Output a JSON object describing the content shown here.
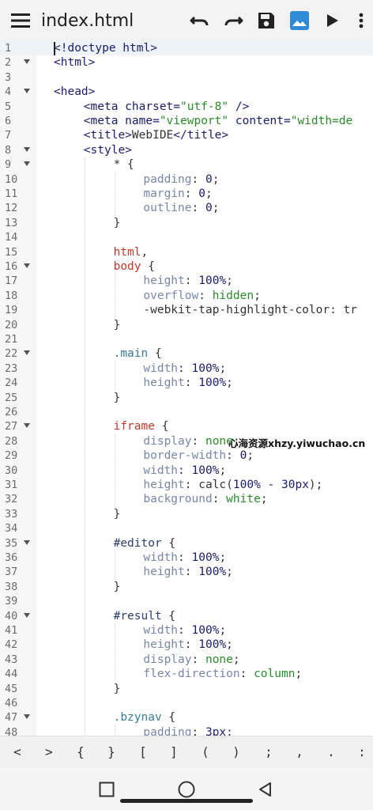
{
  "toolbar": {
    "title": "index.html",
    "icons": [
      "menu-icon",
      "undo-icon",
      "redo-icon",
      "save-icon",
      "image-icon",
      "run-icon",
      "more-vert-icon"
    ]
  },
  "editor": {
    "lines": [
      {
        "n": "1",
        "fold": false,
        "indent": 0,
        "tokens": [
          [
            "tag",
            "<!doctype html>"
          ]
        ]
      },
      {
        "n": "2",
        "fold": true,
        "indent": 0,
        "tokens": [
          [
            "tag",
            "<html>"
          ]
        ]
      },
      {
        "n": "3",
        "fold": false,
        "indent": 0,
        "tokens": []
      },
      {
        "n": "4",
        "fold": true,
        "indent": 0,
        "tokens": [
          [
            "tag",
            "<head>"
          ]
        ]
      },
      {
        "n": "5",
        "fold": false,
        "indent": 1,
        "tokens": [
          [
            "tag",
            "<meta charset="
          ],
          [
            "str",
            "\"utf-8\""
          ],
          [
            "tag",
            " />"
          ]
        ]
      },
      {
        "n": "6",
        "fold": false,
        "indent": 1,
        "tokens": [
          [
            "tag",
            "<meta name="
          ],
          [
            "str",
            "\"viewport\""
          ],
          [
            "tag",
            " content="
          ],
          [
            "str",
            "\"width=de"
          ]
        ]
      },
      {
        "n": "7",
        "fold": false,
        "indent": 1,
        "tokens": [
          [
            "tag",
            "<title>"
          ],
          [
            "punc",
            "WebIDE"
          ],
          [
            "tag",
            "</title>"
          ]
        ]
      },
      {
        "n": "8",
        "fold": true,
        "indent": 1,
        "tokens": [
          [
            "tag",
            "<style>"
          ]
        ]
      },
      {
        "n": "9",
        "fold": true,
        "indent": 2,
        "tokens": [
          [
            "punc",
            "* {"
          ]
        ]
      },
      {
        "n": "10",
        "fold": false,
        "indent": 3,
        "tokens": [
          [
            "prop",
            "padding"
          ],
          [
            "punc",
            ": "
          ],
          [
            "num",
            "0"
          ],
          [
            "punc",
            ";"
          ]
        ]
      },
      {
        "n": "11",
        "fold": false,
        "indent": 3,
        "tokens": [
          [
            "prop",
            "margin"
          ],
          [
            "punc",
            ": "
          ],
          [
            "num",
            "0"
          ],
          [
            "punc",
            ";"
          ]
        ]
      },
      {
        "n": "12",
        "fold": false,
        "indent": 3,
        "tokens": [
          [
            "prop",
            "outline"
          ],
          [
            "punc",
            ": "
          ],
          [
            "num",
            "0"
          ],
          [
            "punc",
            ";"
          ]
        ]
      },
      {
        "n": "13",
        "fold": false,
        "indent": 2,
        "tokens": [
          [
            "punc",
            "}"
          ]
        ]
      },
      {
        "n": "14",
        "fold": false,
        "indent": 0,
        "tokens": []
      },
      {
        "n": "15",
        "fold": false,
        "indent": 2,
        "tokens": [
          [
            "sel",
            "html"
          ],
          [
            "punc",
            ","
          ]
        ]
      },
      {
        "n": "16",
        "fold": true,
        "indent": 2,
        "tokens": [
          [
            "sel",
            "body"
          ],
          [
            "punc",
            " {"
          ]
        ]
      },
      {
        "n": "17",
        "fold": false,
        "indent": 3,
        "tokens": [
          [
            "prop",
            "height"
          ],
          [
            "punc",
            ": "
          ],
          [
            "num",
            "100%"
          ],
          [
            "punc",
            ";"
          ]
        ]
      },
      {
        "n": "18",
        "fold": false,
        "indent": 3,
        "tokens": [
          [
            "prop",
            "overflow"
          ],
          [
            "punc",
            ": "
          ],
          [
            "kw",
            "hidden"
          ],
          [
            "punc",
            ";"
          ]
        ]
      },
      {
        "n": "19",
        "fold": false,
        "indent": 3,
        "tokens": [
          [
            "punc",
            "-webkit-tap-highlight-color: tr"
          ]
        ]
      },
      {
        "n": "20",
        "fold": false,
        "indent": 2,
        "tokens": [
          [
            "punc",
            "}"
          ]
        ]
      },
      {
        "n": "21",
        "fold": false,
        "indent": 0,
        "tokens": []
      },
      {
        "n": "22",
        "fold": true,
        "indent": 2,
        "tokens": [
          [
            "cls",
            ".main"
          ],
          [
            "punc",
            " {"
          ]
        ]
      },
      {
        "n": "23",
        "fold": false,
        "indent": 3,
        "tokens": [
          [
            "prop",
            "width"
          ],
          [
            "punc",
            ": "
          ],
          [
            "num",
            "100%"
          ],
          [
            "punc",
            ";"
          ]
        ]
      },
      {
        "n": "24",
        "fold": false,
        "indent": 3,
        "tokens": [
          [
            "prop",
            "height"
          ],
          [
            "punc",
            ": "
          ],
          [
            "num",
            "100%"
          ],
          [
            "punc",
            ";"
          ]
        ]
      },
      {
        "n": "25",
        "fold": false,
        "indent": 2,
        "tokens": [
          [
            "punc",
            "}"
          ]
        ]
      },
      {
        "n": "26",
        "fold": false,
        "indent": 0,
        "tokens": []
      },
      {
        "n": "27",
        "fold": true,
        "indent": 2,
        "tokens": [
          [
            "sel",
            "iframe"
          ],
          [
            "punc",
            " {"
          ]
        ]
      },
      {
        "n": "28",
        "fold": false,
        "indent": 3,
        "tokens": [
          [
            "prop",
            "display"
          ],
          [
            "punc",
            ": "
          ],
          [
            "kw",
            "none"
          ],
          [
            "punc",
            ";"
          ]
        ]
      },
      {
        "n": "29",
        "fold": false,
        "indent": 3,
        "tokens": [
          [
            "prop",
            "border-width"
          ],
          [
            "punc",
            ": "
          ],
          [
            "num",
            "0"
          ],
          [
            "punc",
            ";"
          ]
        ]
      },
      {
        "n": "30",
        "fold": false,
        "indent": 3,
        "tokens": [
          [
            "prop",
            "width"
          ],
          [
            "punc",
            ": "
          ],
          [
            "num",
            "100%"
          ],
          [
            "punc",
            ";"
          ]
        ]
      },
      {
        "n": "31",
        "fold": false,
        "indent": 3,
        "tokens": [
          [
            "prop",
            "height"
          ],
          [
            "punc",
            ": calc("
          ],
          [
            "num",
            "100% - 30px"
          ],
          [
            "punc",
            ");"
          ]
        ]
      },
      {
        "n": "32",
        "fold": false,
        "indent": 3,
        "tokens": [
          [
            "prop",
            "background"
          ],
          [
            "punc",
            ": "
          ],
          [
            "kw",
            "white"
          ],
          [
            "punc",
            ";"
          ]
        ]
      },
      {
        "n": "33",
        "fold": false,
        "indent": 2,
        "tokens": [
          [
            "punc",
            "}"
          ]
        ]
      },
      {
        "n": "34",
        "fold": false,
        "indent": 0,
        "tokens": []
      },
      {
        "n": "35",
        "fold": true,
        "indent": 2,
        "tokens": [
          [
            "id",
            "#editor"
          ],
          [
            "punc",
            " {"
          ]
        ]
      },
      {
        "n": "36",
        "fold": false,
        "indent": 3,
        "tokens": [
          [
            "prop",
            "width"
          ],
          [
            "punc",
            ": "
          ],
          [
            "num",
            "100%"
          ],
          [
            "punc",
            ";"
          ]
        ]
      },
      {
        "n": "37",
        "fold": false,
        "indent": 3,
        "tokens": [
          [
            "prop",
            "height"
          ],
          [
            "punc",
            ": "
          ],
          [
            "num",
            "100%"
          ],
          [
            "punc",
            ";"
          ]
        ]
      },
      {
        "n": "38",
        "fold": false,
        "indent": 2,
        "tokens": [
          [
            "punc",
            "}"
          ]
        ]
      },
      {
        "n": "39",
        "fold": false,
        "indent": 0,
        "tokens": []
      },
      {
        "n": "40",
        "fold": true,
        "indent": 2,
        "tokens": [
          [
            "id",
            "#result"
          ],
          [
            "punc",
            " {"
          ]
        ]
      },
      {
        "n": "41",
        "fold": false,
        "indent": 3,
        "tokens": [
          [
            "prop",
            "width"
          ],
          [
            "punc",
            ": "
          ],
          [
            "num",
            "100%"
          ],
          [
            "punc",
            ";"
          ]
        ]
      },
      {
        "n": "42",
        "fold": false,
        "indent": 3,
        "tokens": [
          [
            "prop",
            "height"
          ],
          [
            "punc",
            ": "
          ],
          [
            "num",
            "100%"
          ],
          [
            "punc",
            ";"
          ]
        ]
      },
      {
        "n": "43",
        "fold": false,
        "indent": 3,
        "tokens": [
          [
            "prop",
            "display"
          ],
          [
            "punc",
            ": "
          ],
          [
            "kw",
            "none"
          ],
          [
            "punc",
            ";"
          ]
        ]
      },
      {
        "n": "44",
        "fold": false,
        "indent": 3,
        "tokens": [
          [
            "prop",
            "flex-direction"
          ],
          [
            "punc",
            ": "
          ],
          [
            "kw",
            "column"
          ],
          [
            "punc",
            ";"
          ]
        ]
      },
      {
        "n": "45",
        "fold": false,
        "indent": 2,
        "tokens": [
          [
            "punc",
            "}"
          ]
        ]
      },
      {
        "n": "46",
        "fold": false,
        "indent": 0,
        "tokens": []
      },
      {
        "n": "47",
        "fold": true,
        "indent": 2,
        "tokens": [
          [
            "cls",
            ".bzynav"
          ],
          [
            "punc",
            " {"
          ]
        ]
      },
      {
        "n": "48",
        "fold": false,
        "indent": 3,
        "tokens": [
          [
            "prop",
            "padding"
          ],
          [
            "punc",
            ": "
          ],
          [
            "num",
            "3px"
          ],
          [
            "punc",
            ";"
          ]
        ]
      }
    ]
  },
  "watermark": "心海资源xhzy.yiwuchao.cn",
  "symbols": [
    "<",
    ">",
    "{",
    "}",
    "[",
    "]",
    "(",
    ")",
    ";",
    ",",
    ".",
    ":"
  ],
  "navigation": {
    "icons": [
      "recents-square-icon",
      "home-circle-icon",
      "back-triangle-icon"
    ]
  }
}
